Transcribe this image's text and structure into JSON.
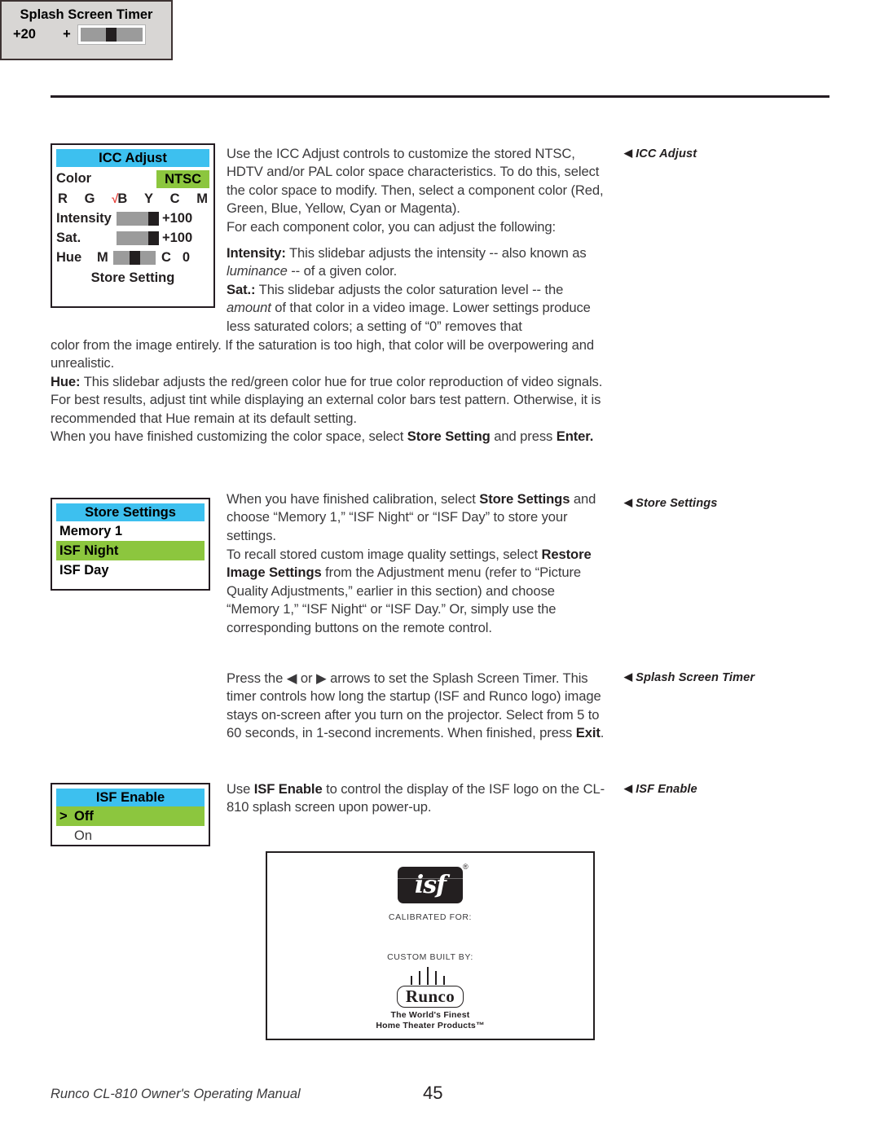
{
  "page": {
    "footer_title": "Runco CL-810 Owner's Operating Manual",
    "page_number": "45"
  },
  "colors": {
    "osd_header": "#3dc0ef",
    "osd_highlight": "#8cc63e",
    "check_mark": "#e8403a",
    "slider_track": "#9b9b9b",
    "slider_thumb": "#231f20",
    "splash_box_bg": "#d8d6d4"
  },
  "callouts": {
    "icc_adjust": "ICC Adjust",
    "store_settings": "Store Settings",
    "splash_screen_timer": "Splash Screen Timer",
    "isf_enable": "ISF Enable",
    "arrow": "◀"
  },
  "icc_menu": {
    "title": "ICC Adjust",
    "color_label": "Color",
    "color_value": "NTSC",
    "components": [
      "R",
      "G",
      "B",
      "Y",
      "C",
      "M"
    ],
    "selected_component": "B",
    "check_glyph": "√",
    "intensity": {
      "label": "Intensity",
      "value": "+100",
      "percent": 78
    },
    "saturation": {
      "label": "Sat.",
      "value": "+100",
      "percent": 78
    },
    "hue": {
      "label": "Hue",
      "left_label": "M",
      "right_label": "C",
      "value": "0",
      "percent": 40
    },
    "store_setting": "Store Setting"
  },
  "store_menu": {
    "title": "Store Settings",
    "items": [
      {
        "label": "Memory 1",
        "selected": false
      },
      {
        "label": "ISF Night",
        "selected": true
      },
      {
        "label": "ISF Day",
        "selected": false
      }
    ]
  },
  "splash_timer_menu": {
    "title": "Splash Screen Timer",
    "value": "+20",
    "plus": "+",
    "percent": 45
  },
  "isf_enable_menu": {
    "title": "ISF Enable",
    "cursor": ">",
    "items": [
      {
        "label": "Off",
        "selected": true
      },
      {
        "label": "On",
        "selected": false
      }
    ]
  },
  "splash_screen": {
    "logo_text": "isf",
    "registered": "®",
    "calibrated_for": "CALIBRATED FOR:",
    "custom_built_by": "CUSTOM BUILT BY:",
    "brand": "Runco",
    "tagline_line1": "The World's Finest",
    "tagline_line2": "Home Theater Products™"
  },
  "body": {
    "p1": "Use the ICC Adjust controls to customize the stored NTSC, HDTV and/or PAL color space characteristics. To do this, select the color space to modify. Then, select a component color (Red, Green, Blue, Yellow, Cyan or Magenta).",
    "p2": "For each component color, you can adjust the following:",
    "p3_lead": "Intensity:",
    "p3_a": " This slidebar adjusts the intensity -- also known as ",
    "p3_i": "luminance",
    "p3_b": " -- of a given color.",
    "p4_lead": "Sat.:",
    "p4_a": " This slidebar adjusts the color saturation level -- the ",
    "p4_i": "amount",
    "p4_b": " of that color in a video image. Lower settings produce less saturated colors; a setting of “0” removes that",
    "p5": "color from the image entirely. If the saturation is too high, that color will be overpowering and unrealistic.",
    "p6_lead": "Hue:",
    "p6_a": " This slidebar adjusts the red/green color hue for true color reproduction of video signals. For best results, adjust tint while displaying an external color bars test pattern. Otherwise, it is recommended that Hue remain at its default setting.",
    "p7_a": "When you have finished customizing the color space, select ",
    "p7_b1": "Store Setting",
    "p7_b": " and press ",
    "p7_b2": "Enter.",
    "p8_a": "When you have finished calibration, select ",
    "p8_b1": "Store Settings",
    "p8_b": " and choose “Memory 1,” “ISF Night“ or “ISF Day” to store your settings.",
    "p9_a": "To recall stored custom image quality settings, select ",
    "p9_b1": "Restore Image Settings",
    "p9_b": " from the Adjustment menu (refer to “Picture Quality Adjustments,” earlier in this section) and choose “Memory 1,” “ISF Night“ or “ISF Day.” Or, simply use the corresponding buttons on the remote control.",
    "p10_a": "Press the ",
    "p10_left": "◀",
    "p10_or": " or ",
    "p10_right": "▶",
    "p10_b": " arrows to set the Splash Screen Timer. This timer controls how long the startup (ISF and Runco logo) image stays on-screen after you turn on the projector. Select from 5 to 60 seconds, in 1-second increments. When finished, press ",
    "p10_b2": "Exit",
    "p10_end": ".",
    "p11_a": "Use ",
    "p11_b1": "ISF Enable",
    "p11_b": " to control the display of the ISF logo on the CL-810 splash screen upon power-up."
  }
}
